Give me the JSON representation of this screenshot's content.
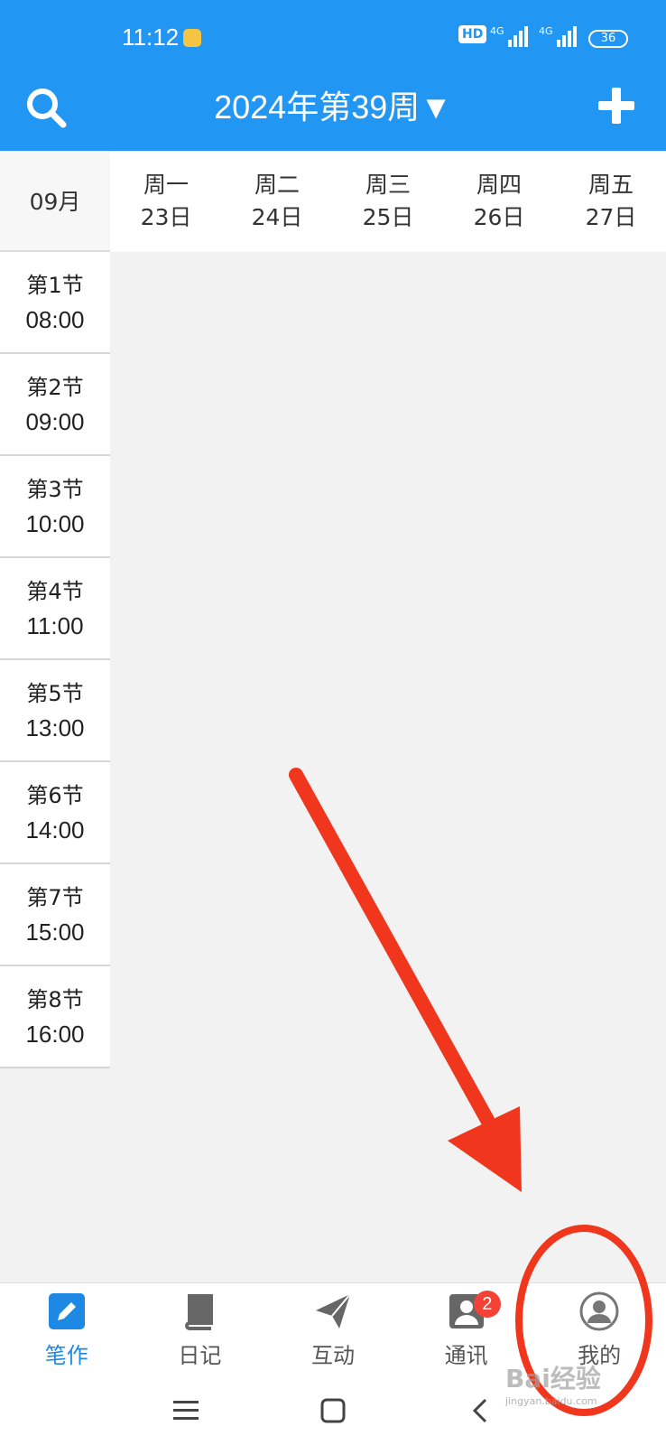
{
  "status_bar": {
    "time": "11:12",
    "hd": "HD",
    "signal1": "4G",
    "signal2": "4G",
    "battery": "36"
  },
  "appbar": {
    "title": "2024年第39周▼",
    "search_icon": "search-icon",
    "add_icon": "plus-icon"
  },
  "week_header": {
    "month": "09月",
    "days": [
      {
        "weekday": "周一",
        "date": "23日"
      },
      {
        "weekday": "周二",
        "date": "24日"
      },
      {
        "weekday": "周三",
        "date": "25日"
      },
      {
        "weekday": "周四",
        "date": "26日"
      },
      {
        "weekday": "周五",
        "date": "27日"
      }
    ]
  },
  "periods": [
    {
      "name": "第1节",
      "time": "08:00"
    },
    {
      "name": "第2节",
      "time": "09:00"
    },
    {
      "name": "第3节",
      "time": "10:00"
    },
    {
      "name": "第4节",
      "time": "11:00"
    },
    {
      "name": "第5节",
      "time": "13:00"
    },
    {
      "name": "第6节",
      "time": "14:00"
    },
    {
      "name": "第7节",
      "time": "15:00"
    },
    {
      "name": "第8节",
      "time": "16:00"
    }
  ],
  "bottom_nav": [
    {
      "label": "笔作",
      "icon": "pencil-icon",
      "active": true
    },
    {
      "label": "日记",
      "icon": "book-icon",
      "active": false
    },
    {
      "label": "互动",
      "icon": "paper-plane-icon",
      "active": false
    },
    {
      "label": "通讯",
      "icon": "contacts-icon",
      "active": false,
      "badge": "2"
    },
    {
      "label": "我的",
      "icon": "user-icon",
      "active": false
    }
  ],
  "watermark": {
    "text": "Bai经验",
    "sub": "jingyan.baidu.com"
  },
  "colors": {
    "primary": "#2196f3",
    "active_nav": "#1e88e5",
    "annotation": "#f0361c",
    "badge": "#f44336"
  }
}
